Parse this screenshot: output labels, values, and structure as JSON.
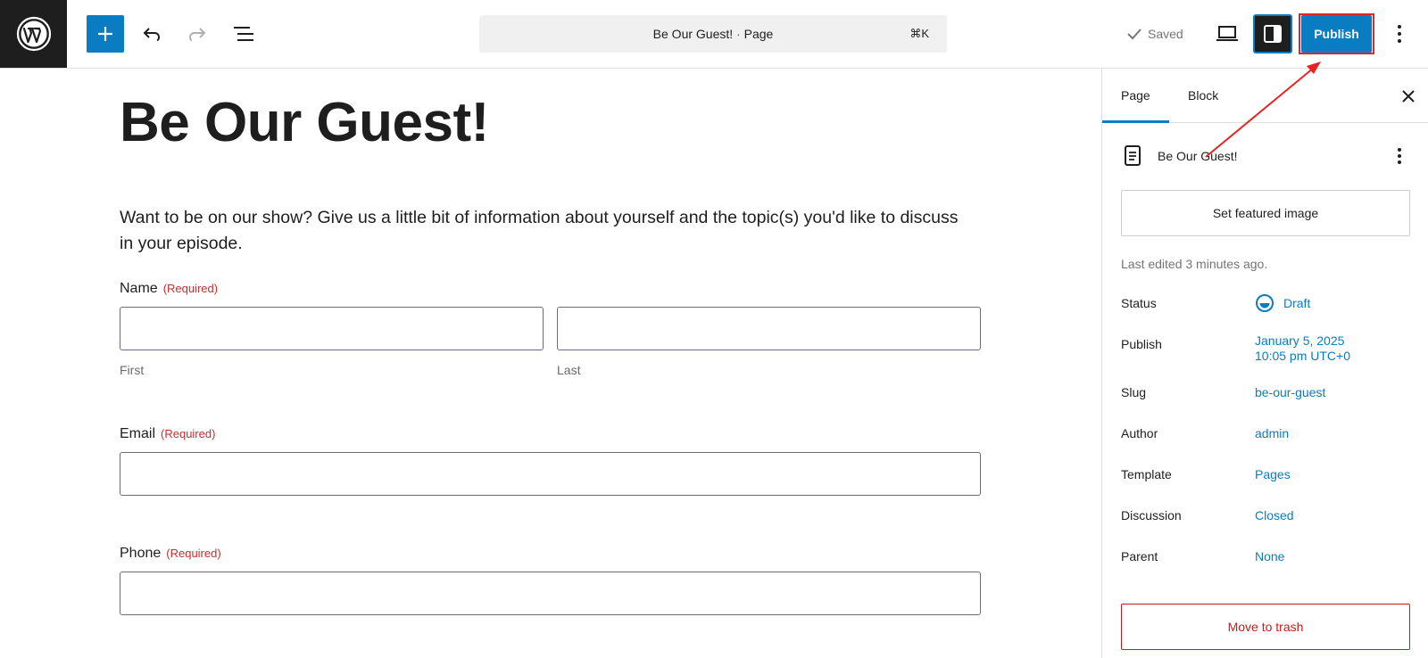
{
  "header": {
    "document_title": "Be Our Guest!",
    "separator": "·",
    "document_type": "Page",
    "shortcut": "⌘K",
    "saved_label": "Saved",
    "publish_label": "Publish"
  },
  "page": {
    "title": "Be Our Guest!",
    "intro": "Want to be on our show? Give us a little bit of information about yourself and the topic(s) you'd like to discuss in your episode.",
    "form": {
      "name_label": "Name",
      "name_required": "(Required)",
      "first_sublabel": "First",
      "last_sublabel": "Last",
      "email_label": "Email",
      "email_required": "(Required)",
      "phone_label": "Phone",
      "phone_required": "(Required)"
    }
  },
  "sidebar": {
    "tabs": [
      {
        "label": "Page"
      },
      {
        "label": "Block"
      }
    ],
    "doc_title": "Be Our Guest!",
    "featured_image_label": "Set featured image",
    "last_edited": "Last edited 3 minutes ago.",
    "meta": {
      "status": {
        "label": "Status",
        "value": "Draft"
      },
      "publish": {
        "label": "Publish",
        "value_line1": "January 5, 2025",
        "value_line2": "10:05 pm UTC+0"
      },
      "slug": {
        "label": "Slug",
        "value": "be-our-guest"
      },
      "author": {
        "label": "Author",
        "value": "admin"
      },
      "template": {
        "label": "Template",
        "value": "Pages"
      },
      "discussion": {
        "label": "Discussion",
        "value": "Closed"
      },
      "parent": {
        "label": "Parent",
        "value": "None"
      }
    },
    "trash_label": "Move to trash"
  },
  "colors": {
    "accent": "#0a7cc1",
    "required": "#c72e2e",
    "danger": "#cc1818",
    "annotation": "#e42525"
  }
}
